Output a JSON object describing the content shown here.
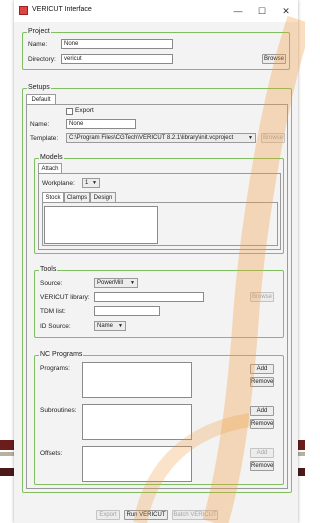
{
  "window": {
    "title": "VERICUT Interface",
    "controls": {
      "minimize": "—",
      "maximize": "☐",
      "close": "✕"
    }
  },
  "project": {
    "group_label": "Project",
    "name_label": "Name:",
    "name_value": "None",
    "directory_label": "Directory:",
    "directory_value": "vericut",
    "browse_label": "Browse"
  },
  "setups": {
    "group_label": "Setups",
    "tab_default": "Default",
    "export_label": "Export",
    "name_label": "Name:",
    "name_value": "None",
    "template_label": "Template:",
    "template_value": "C:\\Program Files\\CGTech\\VERICUT 8.2.1\\library\\init.vcproject",
    "template_browse": "Browse"
  },
  "models": {
    "group_label": "Models",
    "tab_attach": "Attach",
    "workplane_label": "Workplane:",
    "workplane_value": "1",
    "tabs": [
      "Stock",
      "Clamps",
      "Design"
    ]
  },
  "tools": {
    "group_label": "Tools",
    "source_label": "Source:",
    "source_value": "PowerMill",
    "library_label": "VERICUT library:",
    "library_browse": "Browse",
    "tdm_label": "TDM list:",
    "id_source_label": "ID Source:",
    "id_source_value": "Name"
  },
  "nc": {
    "group_label": "NC Programs",
    "programs_label": "Programs:",
    "subroutines_label": "Subroutines:",
    "offsets_label": "Offsets:",
    "add_label": "Add",
    "remove_label": "Remove"
  },
  "footer": {
    "export_label": "Export",
    "run_label": "Run VERICUT",
    "batch_label": "Batch VERICUT"
  },
  "colors": {
    "group_border": "#7fbf5f",
    "window_bg": "#f3f3f3",
    "stripe_dark": "#6b1c1c",
    "orange_swirl": "#f29a3c"
  }
}
